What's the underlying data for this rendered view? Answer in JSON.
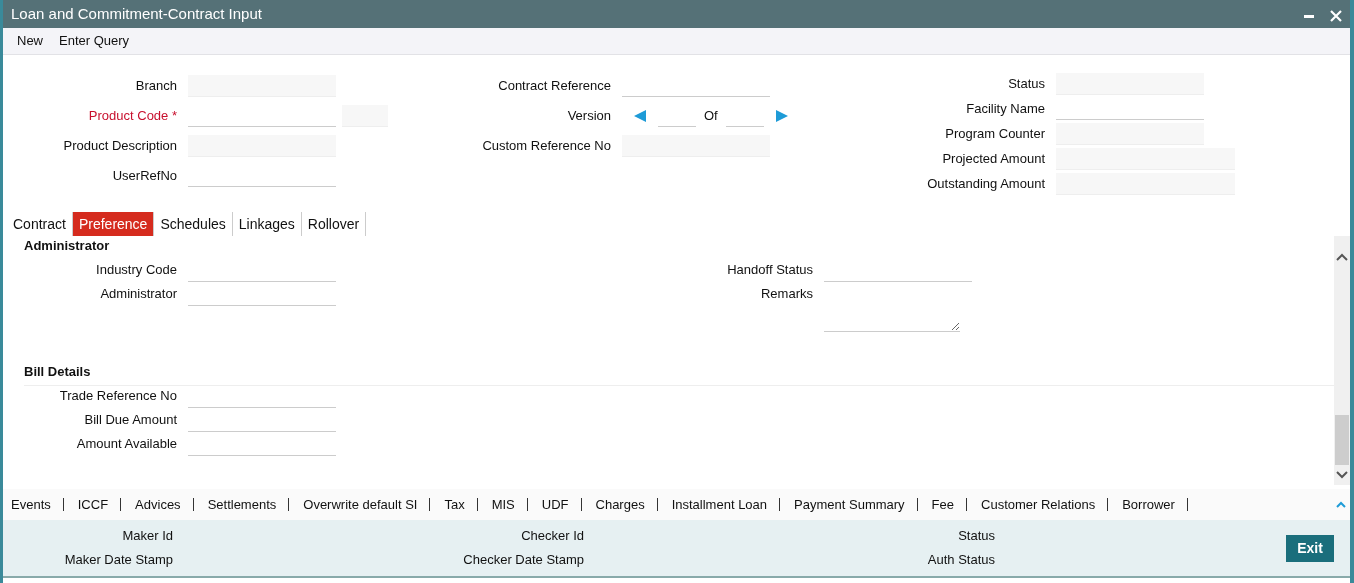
{
  "window": {
    "title": "Loan and Commitment-Contract Input"
  },
  "menu": [
    "New",
    "Enter Query"
  ],
  "header": {
    "columns": [
      [
        {
          "label": "Branch",
          "kind": "readonly",
          "required": false
        },
        {
          "label": "Product Code",
          "kind": "input",
          "required": true,
          "required_mark": "*",
          "extra": true
        },
        {
          "label": "Product Description",
          "kind": "readonly",
          "required": false
        },
        {
          "label": "UserRefNo",
          "kind": "input",
          "required": false
        }
      ],
      [
        {
          "label": "Contract Reference",
          "kind": "input",
          "required": false
        },
        {
          "label": "Version",
          "kind": "version",
          "of_label": "Of",
          "required": false
        },
        {
          "label": "Custom Reference No",
          "kind": "readonly",
          "required": false
        }
      ],
      [
        {
          "label": "Status",
          "kind": "readonly",
          "required": false
        },
        {
          "label": "Facility Name",
          "kind": "input",
          "required": false
        },
        {
          "label": "Program Counter",
          "kind": "readonly",
          "required": false
        },
        {
          "label": "Projected Amount",
          "kind": "readonly-wide",
          "required": false
        },
        {
          "label": "Outstanding Amount",
          "kind": "readonly-wide",
          "required": false
        }
      ]
    ]
  },
  "tabs": [
    {
      "label": "Contract",
      "selected": false
    },
    {
      "label": "Preference",
      "selected": true
    },
    {
      "label": "Schedules",
      "selected": false
    },
    {
      "label": "Linkages",
      "selected": false
    },
    {
      "label": "Rollover",
      "selected": false
    }
  ],
  "sections": [
    {
      "title": "Administrator",
      "left": [
        {
          "label": "Industry Code",
          "kind": "input"
        },
        {
          "label": "Administrator",
          "kind": "input"
        }
      ],
      "right": [
        {
          "label": "Handoff Status",
          "kind": "input"
        },
        {
          "label": "Remarks",
          "kind": "textarea"
        }
      ]
    },
    {
      "title": "Bill Details",
      "left": [
        {
          "label": "Trade Reference No",
          "kind": "input"
        },
        {
          "label": "Bill Due Amount",
          "kind": "input"
        },
        {
          "label": "Amount Available",
          "kind": "input"
        }
      ]
    }
  ],
  "footer_links": [
    "Events",
    "ICCF",
    "Advices",
    "Settlements",
    "Overwrite default SI",
    "Tax",
    "MIS",
    "UDF",
    "Charges",
    "Installment Loan",
    "Payment Summary",
    "Fee",
    "Customer Relations",
    "Borrower"
  ],
  "audit": [
    [
      "Maker Id",
      "Maker Date Stamp"
    ],
    [
      "Checker Id",
      "Checker Date Stamp"
    ],
    [
      "Status",
      "Auth Status"
    ]
  ],
  "exit_button": "Exit"
}
